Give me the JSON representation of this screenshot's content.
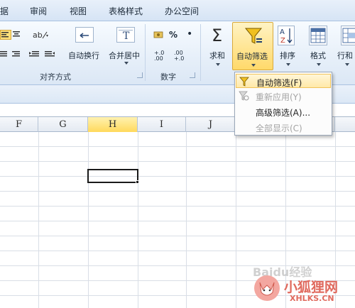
{
  "menu": {
    "tabs": [
      "据",
      "审阅",
      "视图",
      "表格样式",
      "办公空间"
    ]
  },
  "ribbon": {
    "wrap_label": "自动换行",
    "merge_label": "合并居中",
    "align_group": "对齐方式",
    "number_group": "数字",
    "sum_label": "求和",
    "filter_label": "自动筛选",
    "sort_label": "排序",
    "format_label": "格式",
    "rowcol_label": "行和",
    "percent_symbol": "%",
    "comma_symbol": "•",
    "sigma_symbol": "Σ",
    "inc_decimal": "+.0\n.00",
    "inc_decimal_top": "+.0",
    "inc_decimal_bottom": ".00",
    "dec_decimal_top": ".00",
    "dec_decimal_bottom": "+.0"
  },
  "filter_menu": {
    "items": [
      {
        "label": "自动筛选(F)",
        "disabled": false
      },
      {
        "label": "重新应用(Y)",
        "disabled": true
      },
      {
        "label": "高级筛选(A)...",
        "disabled": false
      },
      {
        "label": "全部显示(C)",
        "disabled": true
      }
    ]
  },
  "grid": {
    "columns": [
      "F",
      "G",
      "H",
      "I",
      "J"
    ],
    "active_column": "H"
  },
  "watermark": {
    "baidu": "Baidu经验",
    "brand": "小狐狸网",
    "domain": "XHLKS.CN"
  },
  "colors": {
    "accent": "#ffd95c",
    "ribbon_bg": "#e6eff9",
    "menu_border": "#9aa7b8"
  }
}
